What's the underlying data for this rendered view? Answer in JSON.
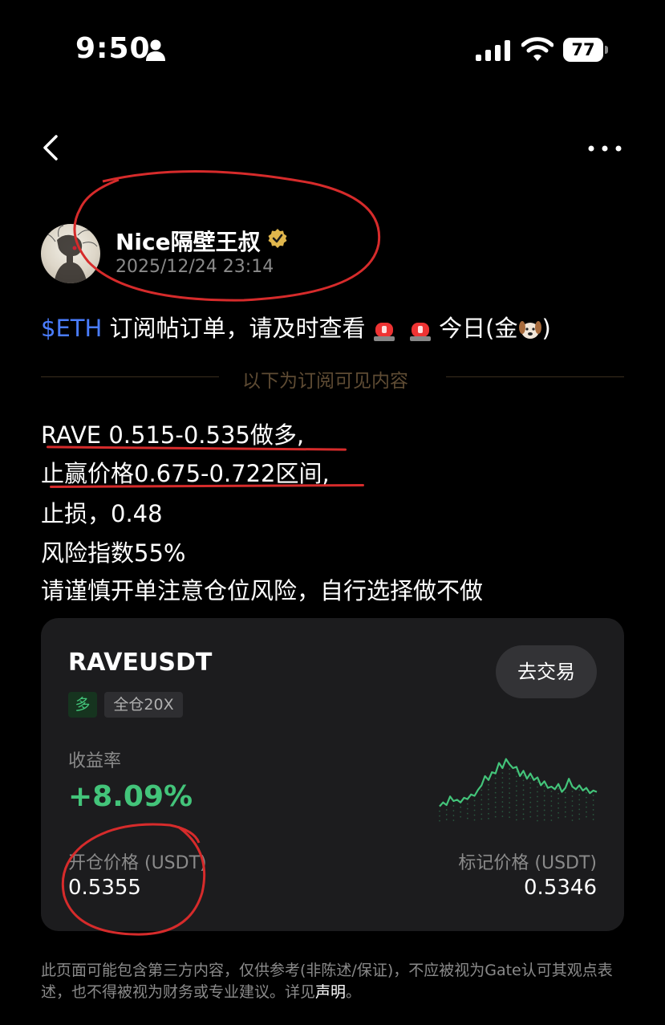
{
  "status_bar": {
    "time": "9:50",
    "battery": "77"
  },
  "author": {
    "name": "Nice隔壁王叔",
    "timestamp": "2025/12/24 23:14"
  },
  "post": {
    "ticker": "$ETH",
    "headline_part1": " 订阅帖订单，请及时查看",
    "headline_part2": " 今日(金",
    "headline_part3": ")",
    "divider_text": "以下为订阅可见内容",
    "lines": [
      "RAVE 0.515-0.535做多,",
      "止赢价格0.675-0.722区间,",
      "止损，0.48",
      "风险指数55%",
      "请谨慎开单注意仓位风险，自行选择做不做"
    ]
  },
  "card": {
    "pair": "RAVEUSDT",
    "trade_button": "去交易",
    "tag_direction": "多",
    "tag_margin": "全仓20X",
    "yield_label": "收益率",
    "yield_value": "+8.09%",
    "open_price_label": "开仓价格 (USDT)",
    "open_price_value": "0.5355",
    "mark_price_label": "标记价格 (USDT)",
    "mark_price_value": "0.5346",
    "sparkline_color": "#43c47a",
    "sparkline_values": [
      0.2,
      0.26,
      0.22,
      0.35,
      0.28,
      0.3,
      0.26,
      0.33,
      0.31,
      0.38,
      0.36,
      0.45,
      0.52,
      0.66,
      0.6,
      0.72,
      0.7,
      0.86,
      0.78,
      0.92,
      0.84,
      0.78,
      0.8,
      0.66,
      0.74,
      0.62,
      0.7,
      0.6,
      0.64,
      0.52,
      0.58,
      0.48,
      0.5,
      0.46,
      0.54,
      0.42,
      0.48,
      0.62,
      0.5,
      0.46,
      0.52,
      0.44,
      0.48,
      0.4,
      0.44,
      0.42
    ]
  },
  "disclaimer": {
    "text": "此页面可能包含第三方内容，仅供参考(非陈述/保证)，不应被视为Gate认可其观点表述，也不得被视为财务或专业建议。详见",
    "link": "声明",
    "end": "。"
  },
  "colors": {
    "accent_green": "#43c47a",
    "ticker_blue": "#4a7dff",
    "annotation_red": "#d62b2b"
  }
}
